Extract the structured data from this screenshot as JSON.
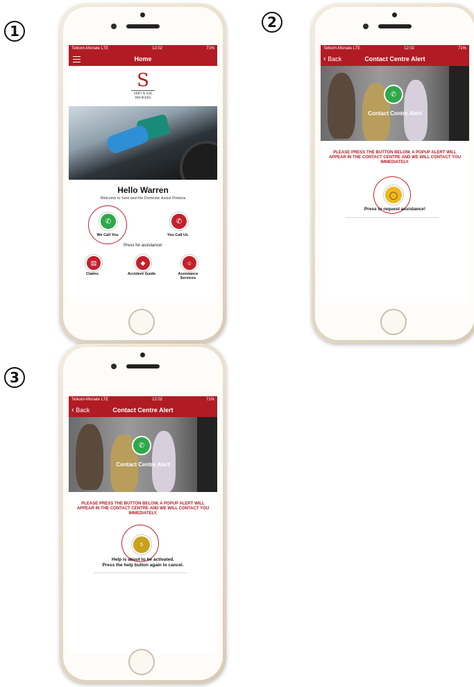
{
  "steps": [
    "1",
    "2",
    "3"
  ],
  "status": {
    "carrier": "Telkom-Monate  LTE",
    "time": "12:02",
    "battery": "71%"
  },
  "screen1": {
    "nav_title": "Home",
    "logo": {
      "letter": "S",
      "line1": "SMIT & KIE",
      "line2": "BROKERS"
    },
    "hello": "Hello Warren",
    "welcome": "Welcome to Smit and Kie Domestic Assist Pretoria",
    "we_call_label": "We Call You",
    "you_call_label": "You Call Us",
    "press_assist": "Press for assistance!",
    "services": [
      {
        "label": "Claims",
        "icon": "claims-icon"
      },
      {
        "label": "Accident Guide",
        "icon": "car-accident-icon"
      },
      {
        "label": "Assistance Services",
        "icon": "24h-assist-icon"
      }
    ],
    "colors": {
      "brand_red": "#b11b24",
      "green": "#2ea84a",
      "red_btn": "#c4202b"
    }
  },
  "screen2": {
    "back": "Back",
    "nav_title": "Contact Centre Alert",
    "hero_label": "Contact Centre Alert",
    "alert_text": "PLEASE PRESS THE BUTTON BELOW. A POPUP ALERT WILL APPEAR IN THE CONTACT CENTRE AND WE WILL CONTACT YOU IMMEDIATELY.",
    "press_label": "Press to request assistance!",
    "bell_color": "#f1b81c"
  },
  "screen3": {
    "back": "Back",
    "nav_title": "Contact Centre Alert",
    "hero_label": "Contact Centre Alert",
    "alert_text": "PLEASE PRESS THE BUTTON BELOW. A POPUP ALERT WILL APPEAR IN THE CONTACT CENTRE AND WE WILL CONTACT YOU IMMEDIATELY.",
    "countdown": "5",
    "help_line1": "Help is about to be activated.",
    "help_line2": "Press the help button again to cancel.",
    "countdown_color": "#c9a21b"
  }
}
